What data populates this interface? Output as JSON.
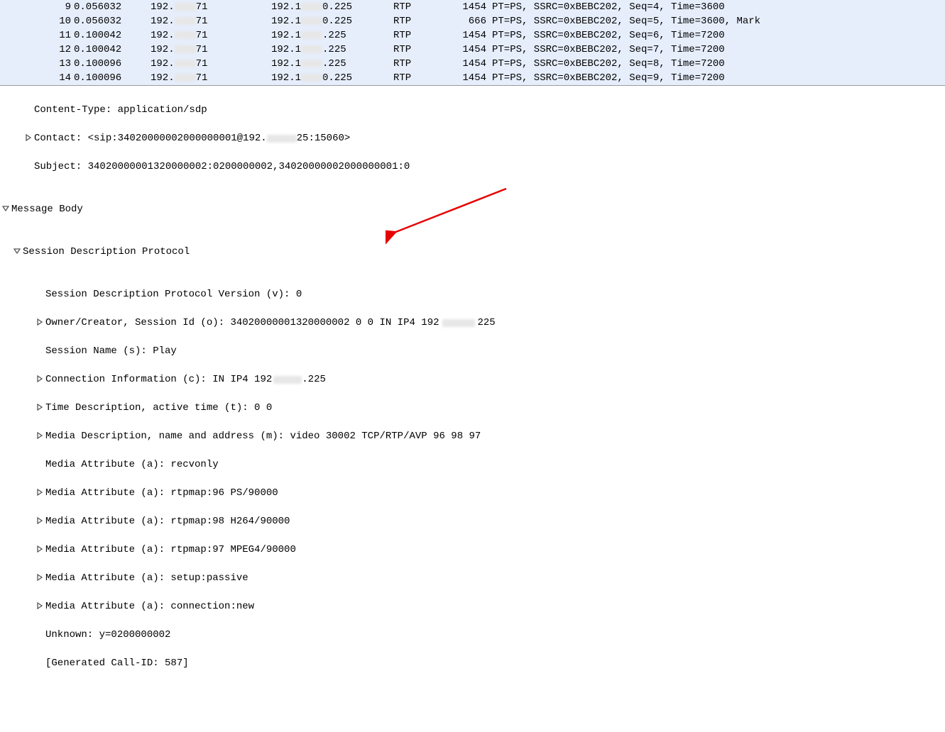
{
  "packets": [
    {
      "num": "9",
      "time": "0.056032",
      "src_a": "192.",
      "src_b": "71",
      "dst_a": "192.1",
      "dst_b": "0.225",
      "proto": "RTP",
      "len": "1454",
      "info": "PT=PS, SSRC=0xBEBC202, Seq=4, Time=3600"
    },
    {
      "num": "10",
      "time": "0.056032",
      "src_a": "192.",
      "src_b": "71",
      "dst_a": "192.1",
      "dst_b": "0.225",
      "proto": "RTP",
      "len": "666",
      "info": "PT=PS, SSRC=0xBEBC202, Seq=5, Time=3600, Mark"
    },
    {
      "num": "11",
      "time": "0.100042",
      "src_a": "192.",
      "src_b": "71",
      "dst_a": "192.1",
      "dst_b": ".225",
      "proto": "RTP",
      "len": "1454",
      "info": "PT=PS, SSRC=0xBEBC202, Seq=6, Time=7200"
    },
    {
      "num": "12",
      "time": "0.100042",
      "src_a": "192.",
      "src_b": "71",
      "dst_a": "192.1",
      "dst_b": ".225",
      "proto": "RTP",
      "len": "1454",
      "info": "PT=PS, SSRC=0xBEBC202, Seq=7, Time=7200"
    },
    {
      "num": "13",
      "time": "0.100096",
      "src_a": "192.",
      "src_b": "71",
      "dst_a": "192.1",
      "dst_b": ".225",
      "proto": "RTP",
      "len": "1454",
      "info": "PT=PS, SSRC=0xBEBC202, Seq=8, Time=7200"
    },
    {
      "num": "14",
      "time": "0.100096",
      "src_a": "192.",
      "src_b": "71",
      "dst_a": "192.1",
      "dst_b": "0.225",
      "proto": "RTP",
      "len": "1454",
      "info": "PT=PS, SSRC=0xBEBC202, Seq=9, Time=7200"
    }
  ],
  "detail": {
    "content_type": "Content-Type: application/sdp",
    "contact_a": "Contact: <sip:34020000002000000001@192.",
    "contact_b": "25:15060>",
    "subject": "Subject: 34020000001320000002:0200000002,34020000002000000001:0",
    "msgbody": "Message Body",
    "sdp": "Session Description Protocol",
    "sdp_v": "Session Description Protocol Version (v): 0",
    "sdp_o_a": "Owner/Creator, Session Id (o): 34020000001320000002 0 0 IN IP4 192",
    "sdp_o_b": "225",
    "sdp_s": "Session Name (s): Play",
    "sdp_c_a": "Connection Information (c): IN IP4 192",
    "sdp_c_b": ".225",
    "sdp_t": "Time Description, active time (t): 0 0",
    "sdp_m": "Media Description, name and address (m): video 30002 TCP/RTP/AVP 96 98 97",
    "sdp_a1": "Media Attribute (a): recvonly",
    "sdp_a2": "Media Attribute (a): rtpmap:96 PS/90000",
    "sdp_a3": "Media Attribute (a): rtpmap:98 H264/90000",
    "sdp_a4": "Media Attribute (a): rtpmap:97 MPEG4/90000",
    "sdp_a5": "Media Attribute (a): setup:passive",
    "sdp_a6": "Media Attribute (a): connection:new",
    "sdp_y": "Unknown: y=0200000002",
    "sdp_call": "[Generated Call-ID: 587]"
  }
}
